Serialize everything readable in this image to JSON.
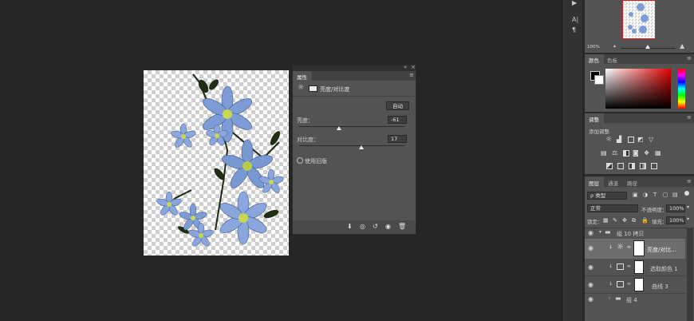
{
  "properties_panel": {
    "tab": "属性",
    "title": "亮度/对比度",
    "auto_button": "自动",
    "brightness_label": "亮度：",
    "brightness_value": "-61",
    "brightness_level": 0.38,
    "contrast_label": "对比度：",
    "contrast_value": "17",
    "contrast_level": 0.59,
    "legacy_label": "使用旧版",
    "collapse_glyph": "«"
  },
  "toolbar_right": {
    "text_tool": "A|",
    "paragraph": "¶",
    "play": "▶"
  },
  "navigator": {
    "zoom": "100%"
  },
  "color_panel": {
    "tab_color": "颜色",
    "tab_swatches": "色板"
  },
  "adjustments_panel": {
    "tab": "调整",
    "subtitle": "添加调整"
  },
  "layers_panel": {
    "tab_layers": "图层",
    "tab_channels": "通道",
    "tab_paths": "路径",
    "filter_kind": "ρ 类型",
    "blend_mode": "正常",
    "opacity_label": "不透明度：",
    "opacity_value": "100%",
    "lock_label": "锁定：",
    "fill_label": "填充：",
    "fill_value": "100%",
    "layers": [
      {
        "name": "组 10 拷贝",
        "type": "group-open"
      },
      {
        "name": "亮度/对比...",
        "type": "adjustment-brightness"
      },
      {
        "name": "选取颜色 1",
        "type": "adjustment-selective"
      },
      {
        "name": "曲线 3",
        "type": "adjustment-curves"
      },
      {
        "name": "组 4",
        "type": "group-closed"
      }
    ]
  },
  "colors": {
    "app_bg": "#262626",
    "panel_bg": "#535353",
    "accent_red": "#d02020",
    "flower_blue": "#7e9cd6"
  }
}
